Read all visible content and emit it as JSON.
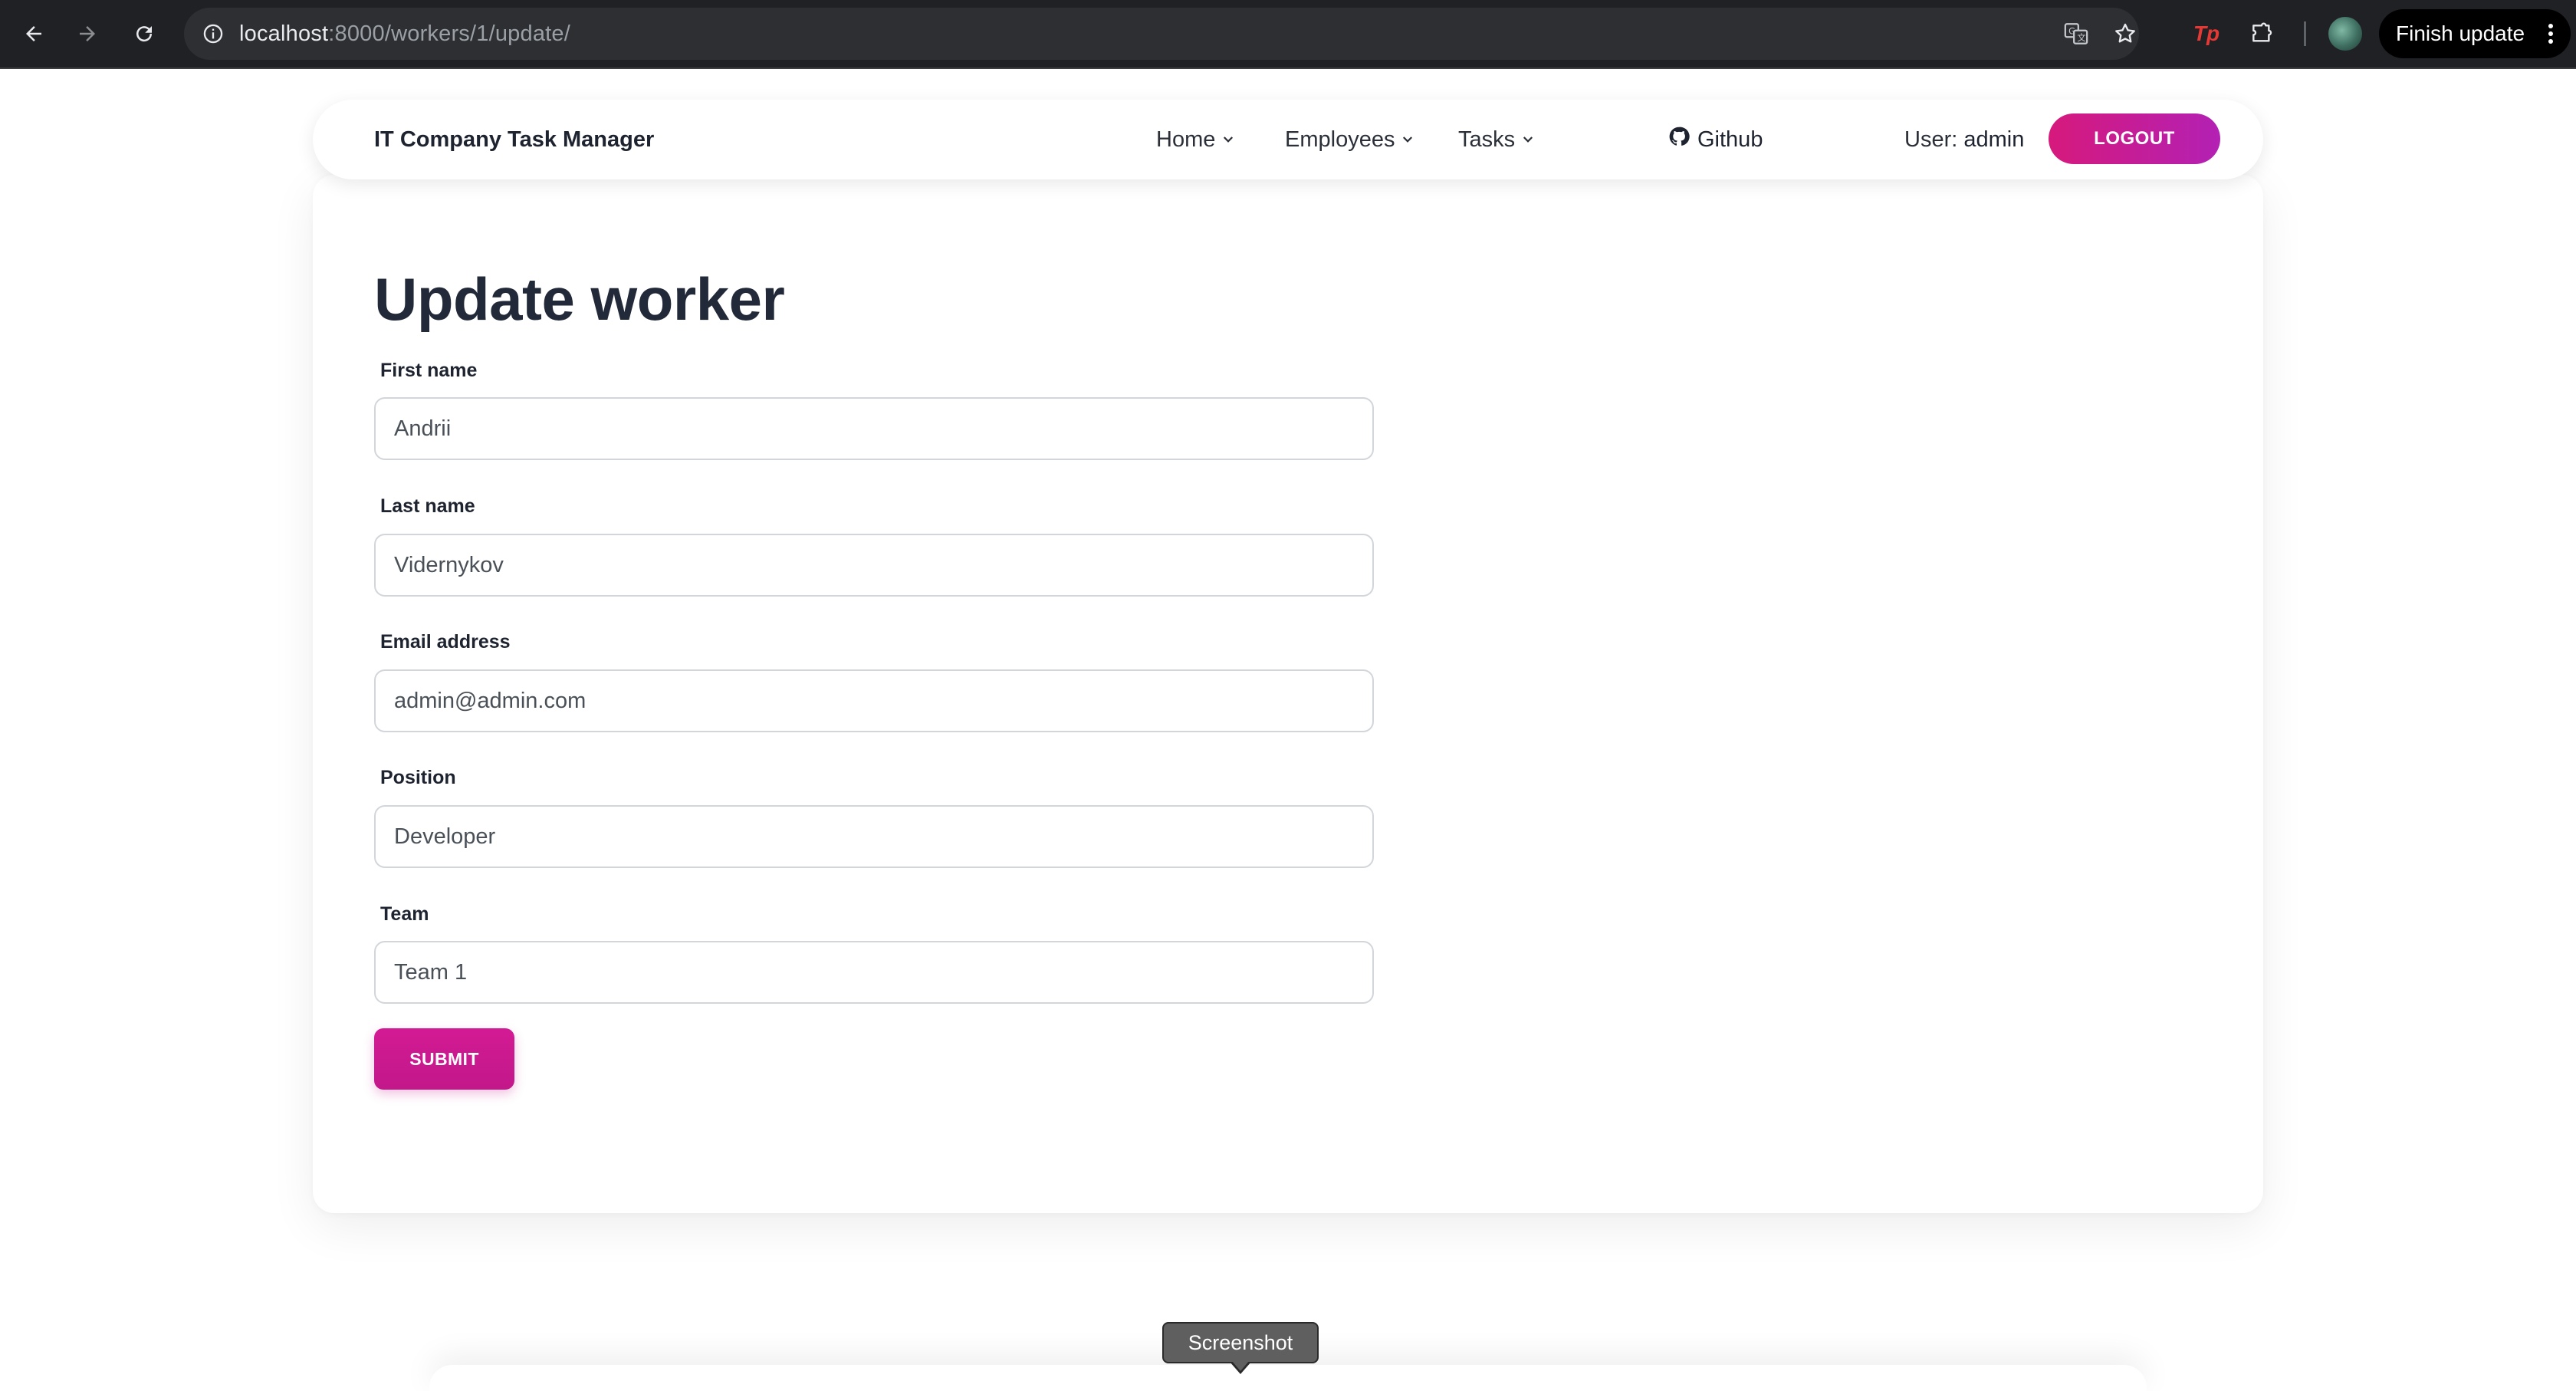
{
  "browser": {
    "url_host": "localhost",
    "url_path": ":8000/workers/1/update/",
    "finish_update_label": "Finish update",
    "extension_badge": "Tp"
  },
  "navbar": {
    "brand": "IT Company Task Manager",
    "menu": [
      {
        "label": "Home"
      },
      {
        "label": "Employees"
      },
      {
        "label": "Tasks"
      }
    ],
    "github_label": "Github",
    "user_prefix": "User: ",
    "username": "admin",
    "logout_label": "LOGOUT"
  },
  "form": {
    "title": "Update worker",
    "fields": [
      {
        "label": "First name",
        "value": "Andrii"
      },
      {
        "label": "Last name",
        "value": "Vidernykov"
      },
      {
        "label": "Email address",
        "value": "admin@admin.com"
      },
      {
        "label": "Position",
        "value": "Developer"
      },
      {
        "label": "Team",
        "value": "Team 1"
      }
    ],
    "submit_label": "SUBMIT"
  },
  "tooltip": {
    "text": "Screenshot"
  },
  "colors": {
    "accent": "#d6197c",
    "accent_end": "#b321b4",
    "chrome_bg": "#202124"
  }
}
